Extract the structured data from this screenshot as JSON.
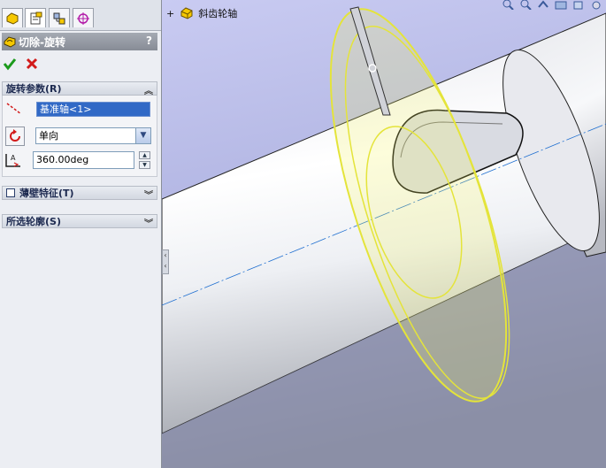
{
  "panel": {
    "tabs": [
      {
        "name": "feature-manager-tab"
      },
      {
        "name": "property-manager-tab"
      },
      {
        "name": "configuration-manager-tab"
      },
      {
        "name": "dim-xpert-tab"
      }
    ],
    "title": "切除-旋转",
    "help": "?",
    "rotation_params": {
      "header": "旋转参数(R)",
      "axis_value": "基准轴<1>",
      "direction_value": "单向",
      "angle_value": "360.00deg"
    },
    "thin_feature": {
      "header": "薄壁特征(T)"
    },
    "selected_contours": {
      "header": "所选轮廓(S)"
    }
  },
  "tree": {
    "expand": "+",
    "label": "斜齿轮轴"
  },
  "colors": {
    "panel_bg": "#eceef3",
    "title_bg": "#878c96",
    "selection": "#3169c6",
    "highlight": "#f5f55a",
    "ok_green": "#1b9a1b",
    "cancel_red": "#d21a1a"
  }
}
